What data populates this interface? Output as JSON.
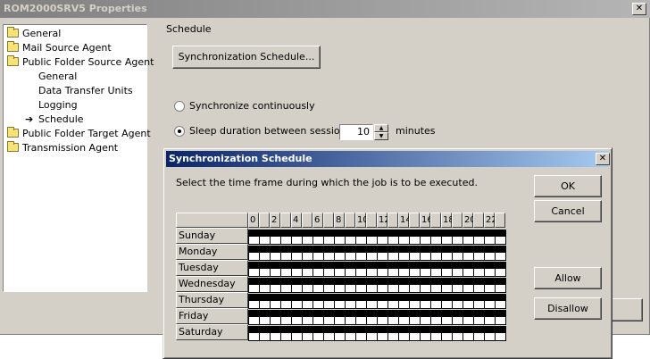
{
  "properties_window": {
    "title": "ROM2000SRV5 Properties",
    "tree": [
      {
        "label": "General",
        "icon": "folder-icon",
        "indent": 0
      },
      {
        "label": "Mail Source Agent",
        "icon": "folder-icon",
        "indent": 0
      },
      {
        "label": "Public Folder Source Agent",
        "icon": "folder-icon",
        "indent": 0
      },
      {
        "label": "General",
        "icon": "",
        "indent": 1
      },
      {
        "label": "Data Transfer Units",
        "icon": "",
        "indent": 1
      },
      {
        "label": "Logging",
        "icon": "",
        "indent": 1
      },
      {
        "label": "Schedule",
        "icon": "arrow-icon",
        "indent": 1
      },
      {
        "label": "Public Folder Target Agent",
        "icon": "folder-icon",
        "indent": 0
      },
      {
        "label": "Transmission Agent",
        "icon": "folder-icon",
        "indent": 0
      }
    ],
    "section_label": "Schedule",
    "sync_schedule_button": "Synchronization Schedule...",
    "radio_continuous": "Synchronize continuously",
    "radio_sleep": "Sleep duration between sessions:",
    "sleep_value": "10",
    "minutes_label": "minutes"
  },
  "schedule_dialog": {
    "title": "Synchronization Schedule",
    "instruction": "Select the time frame during which the job is to be executed.",
    "ok_button": "OK",
    "cancel_button": "Cancel",
    "allow_button": "Allow",
    "disallow_button": "Disallow",
    "close_glyph": "✕",
    "hour_labels": [
      "0",
      "",
      "2",
      "",
      "4",
      "",
      "6",
      "",
      "8",
      "",
      "10",
      "",
      "12",
      "",
      "14",
      "",
      "16",
      "",
      "18",
      "",
      "20",
      "",
      "22",
      ""
    ],
    "days": [
      "Sunday",
      "Monday",
      "Tuesday",
      "Wednesday",
      "Thursday",
      "Friday",
      "Saturday"
    ]
  },
  "colors": {
    "dialog_title_bar": "#0a246a",
    "inactive_title_bar": "#808080",
    "face": "#d4d0c8"
  }
}
